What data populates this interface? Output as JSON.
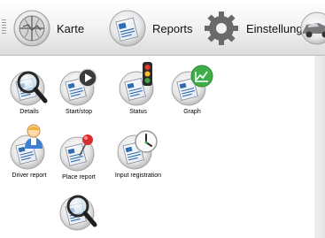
{
  "nav": [
    {
      "label": "Karte",
      "icon": "map-globe-icon"
    },
    {
      "label": "Reports",
      "icon": "reports-icon"
    },
    {
      "label": "Einstellungen",
      "icon": "gear-icon"
    },
    {
      "label": "",
      "icon": "car-icon"
    }
  ],
  "tiles": [
    {
      "label": "Details",
      "icon": "magnifier-icon"
    },
    {
      "label": "Start/stop",
      "icon": "play-icon"
    },
    {
      "label": "Status",
      "icon": "traffic-light-icon"
    },
    {
      "label": "Graph",
      "icon": "graph-icon"
    },
    {
      "label": "Driver report",
      "icon": "driver-icon"
    },
    {
      "label": "Place report",
      "icon": "pin-icon"
    },
    {
      "label": "Input registration",
      "icon": "clock-icon"
    },
    {
      "label": "",
      "icon": "magnifier-icon"
    }
  ],
  "colors": {
    "accent_green": "#3fae49",
    "doc_blue": "#2f6db5"
  }
}
